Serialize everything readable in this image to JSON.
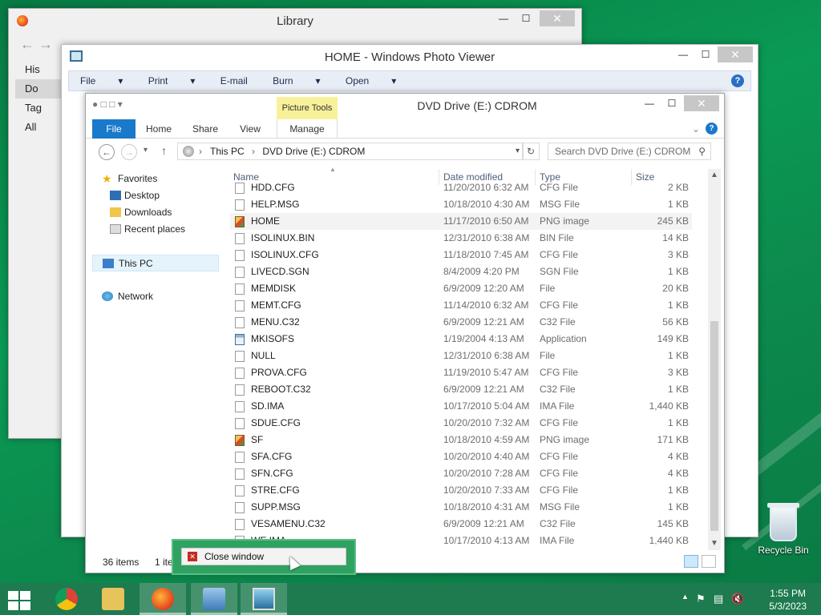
{
  "library": {
    "title": "Library",
    "sidebar": [
      {
        "label": "His"
      },
      {
        "label": "Do"
      },
      {
        "label": "Tag"
      },
      {
        "label": "All"
      }
    ]
  },
  "photo_viewer": {
    "title": "HOME - Windows Photo Viewer",
    "menu": [
      "File",
      "Print",
      "E-mail",
      "Burn",
      "Open"
    ],
    "help": "?"
  },
  "explorer": {
    "title": "DVD Drive (E:) CDROM",
    "picture_tools": "Picture Tools",
    "ribbon_tabs": [
      "File",
      "Home",
      "Share",
      "View",
      "Manage"
    ],
    "address": {
      "this_pc": "This PC",
      "drive": "DVD Drive (E:) CDROM"
    },
    "search_placeholder": "Search DVD Drive (E:) CDROM",
    "nav": {
      "favorites": "Favorites",
      "desktop": "Desktop",
      "downloads": "Downloads",
      "recent": "Recent places",
      "this_pc": "This PC",
      "network": "Network"
    },
    "columns": {
      "name": "Name",
      "date": "Date modified",
      "type": "Type",
      "size": "Size"
    },
    "files": [
      {
        "name": "HDD.CFG",
        "date": "11/20/2010 6:32 AM",
        "type": "CFG File",
        "size": "2 KB",
        "icon": "file"
      },
      {
        "name": "HELP.MSG",
        "date": "10/18/2010 4:30 AM",
        "type": "MSG File",
        "size": "1 KB",
        "icon": "file"
      },
      {
        "name": "HOME",
        "date": "11/17/2010 6:50 AM",
        "type": "PNG image",
        "size": "245 KB",
        "icon": "png"
      },
      {
        "name": "ISOLINUX.BIN",
        "date": "12/31/2010 6:38 AM",
        "type": "BIN File",
        "size": "14 KB",
        "icon": "file"
      },
      {
        "name": "ISOLINUX.CFG",
        "date": "11/18/2010 7:45 AM",
        "type": "CFG File",
        "size": "3 KB",
        "icon": "file"
      },
      {
        "name": "LIVECD.SGN",
        "date": "8/4/2009 4:20 PM",
        "type": "SGN File",
        "size": "1 KB",
        "icon": "file"
      },
      {
        "name": "MEMDISK",
        "date": "6/9/2009 12:20 AM",
        "type": "File",
        "size": "20 KB",
        "icon": "file"
      },
      {
        "name": "MEMT.CFG",
        "date": "11/14/2010 6:32 AM",
        "type": "CFG File",
        "size": "1 KB",
        "icon": "file"
      },
      {
        "name": "MENU.C32",
        "date": "6/9/2009 12:21 AM",
        "type": "C32 File",
        "size": "56 KB",
        "icon": "file"
      },
      {
        "name": "MKISOFS",
        "date": "1/19/2004 4:13 AM",
        "type": "Application",
        "size": "149 KB",
        "icon": "app"
      },
      {
        "name": "NULL",
        "date": "12/31/2010 6:38 AM",
        "type": "File",
        "size": "1 KB",
        "icon": "file"
      },
      {
        "name": "PROVA.CFG",
        "date": "11/19/2010 5:47 AM",
        "type": "CFG File",
        "size": "3 KB",
        "icon": "file"
      },
      {
        "name": "REBOOT.C32",
        "date": "6/9/2009 12:21 AM",
        "type": "C32 File",
        "size": "1 KB",
        "icon": "file"
      },
      {
        "name": "SD.IMA",
        "date": "10/17/2010 5:04 AM",
        "type": "IMA File",
        "size": "1,440 KB",
        "icon": "file"
      },
      {
        "name": "SDUE.CFG",
        "date": "10/20/2010 7:32 AM",
        "type": "CFG File",
        "size": "1 KB",
        "icon": "file"
      },
      {
        "name": "SF",
        "date": "10/18/2010 4:59 AM",
        "type": "PNG image",
        "size": "171 KB",
        "icon": "png"
      },
      {
        "name": "SFA.CFG",
        "date": "10/20/2010 4:40 AM",
        "type": "CFG File",
        "size": "4 KB",
        "icon": "file"
      },
      {
        "name": "SFN.CFG",
        "date": "10/20/2010 7:28 AM",
        "type": "CFG File",
        "size": "4 KB",
        "icon": "file"
      },
      {
        "name": "STRE.CFG",
        "date": "10/20/2010 7:33 AM",
        "type": "CFG File",
        "size": "1 KB",
        "icon": "file"
      },
      {
        "name": "SUPP.MSG",
        "date": "10/18/2010 4:31 AM",
        "type": "MSG File",
        "size": "1 KB",
        "icon": "file"
      },
      {
        "name": "VESAMENU.C32",
        "date": "6/9/2009 12:21 AM",
        "type": "C32 File",
        "size": "145 KB",
        "icon": "file"
      },
      {
        "name": "WE.IMA",
        "date": "10/17/2010 4:13 AM",
        "type": "IMA File",
        "size": "1,440 KB",
        "icon": "file"
      }
    ],
    "status": {
      "count": "36 items",
      "selected": "1 ite"
    }
  },
  "popup": {
    "close_label": "Close window"
  },
  "desktop": {
    "recycle_bin": "Recycle Bin"
  },
  "taskbar": {
    "time": "1:55 PM",
    "date": "5/3/2023"
  },
  "colors": {
    "desktop": "#0a9a55",
    "file_tab": "#1979ca",
    "picture_tools": "#f8f19a"
  }
}
